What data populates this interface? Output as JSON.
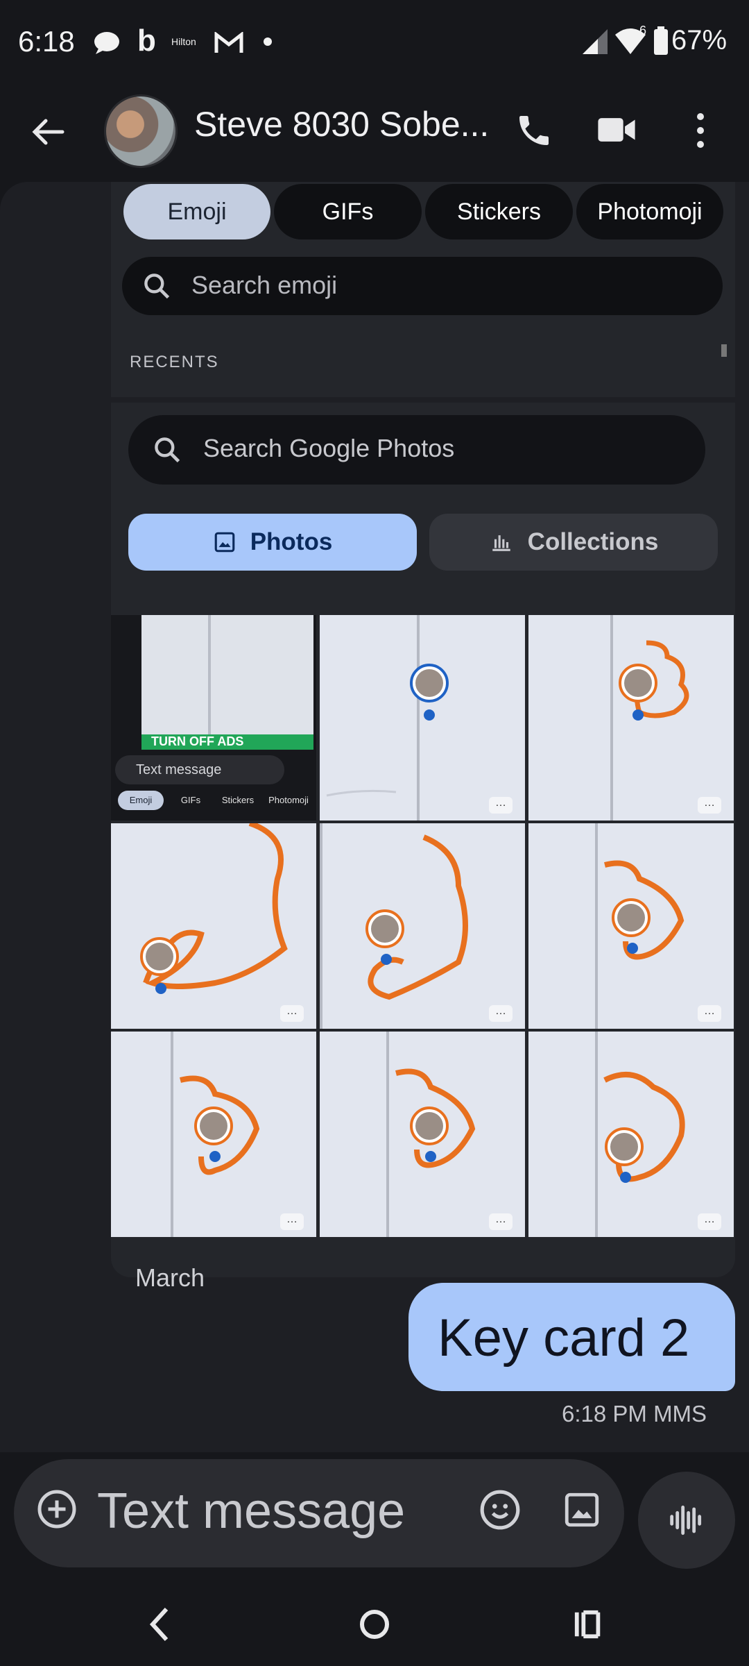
{
  "status_bar": {
    "time": "6:18",
    "hilton_label": "Hilton",
    "signal_badge": "6",
    "battery": "67%"
  },
  "app_bar": {
    "contact_name": "Steve 8030 Sobe..."
  },
  "emoji_picker": {
    "tabs": [
      "Emoji",
      "GIFs",
      "Stickers",
      "Photomoji"
    ],
    "active_tab": "Emoji",
    "search_placeholder": "Search emoji",
    "section": "RECENTS"
  },
  "photos_picker": {
    "search_placeholder": "Search Google Photos",
    "segments": [
      "Photos",
      "Collections"
    ],
    "active_segment": "Photos",
    "next_section": "March",
    "thumb_preview": {
      "compose_placeholder": "Text message",
      "tabs": [
        "Emoji",
        "GIFs",
        "Stickers",
        "Photomoji"
      ],
      "banner": "TURN OFF ADS"
    }
  },
  "conversation": {
    "message": "Key card 2",
    "meta": "6:18 PM MMS"
  },
  "compose": {
    "placeholder": "Text message"
  },
  "colors": {
    "accent": "#a8c7fa",
    "route": "#e8701e",
    "background": "#16171b"
  },
  "icons": [
    "back-arrow-icon",
    "phone-icon",
    "video-icon",
    "more-vert-icon",
    "search-icon",
    "photo-icon",
    "collections-icon",
    "add-icon",
    "emoji-icon",
    "gallery-icon",
    "voice-icon",
    "nav-back-icon",
    "nav-home-icon",
    "nav-recents-icon"
  ]
}
